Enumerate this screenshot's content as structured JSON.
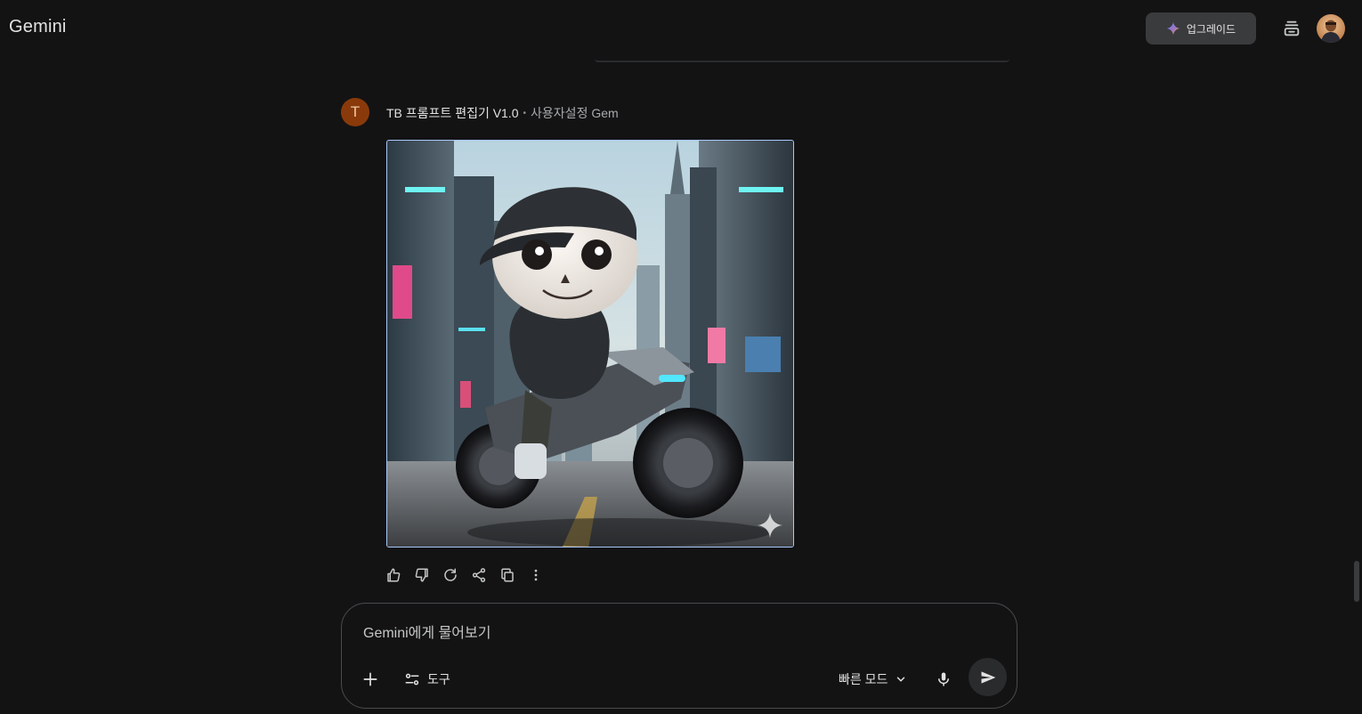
{
  "header": {
    "app_title": "Gemini",
    "upgrade_label": "업그레이드",
    "upgrade_icon": "gemini-sparkle-icon",
    "temp_chat_icon": "temporary-chat-icon",
    "account_icon": "avatar"
  },
  "message": {
    "gem_initial": "T",
    "gem_name": "TB 프롬프트 편집기 V1.0",
    "separator": "•",
    "gem_type": "사용자설정 Gem",
    "image_icon": "generated-image",
    "watermark_icon": "gemini-sparkle-watermark-icon",
    "actions": [
      {
        "name": "thumb-up-icon"
      },
      {
        "name": "thumb-down-icon"
      },
      {
        "name": "regenerate-icon"
      },
      {
        "name": "share-icon"
      },
      {
        "name": "copy-icon"
      },
      {
        "name": "more-vert-icon"
      }
    ]
  },
  "composer": {
    "placeholder": "Gemini에게 물어보기",
    "value": "",
    "add_icon": "plus-icon",
    "tools_label": "도구",
    "mode_label": "빠른 모드",
    "mic_icon": "mic-icon",
    "send_icon": "send-icon"
  },
  "colors": {
    "background": "#131314",
    "image_border": "#a8c7fa",
    "gem_avatar": "#8a3a0a"
  }
}
